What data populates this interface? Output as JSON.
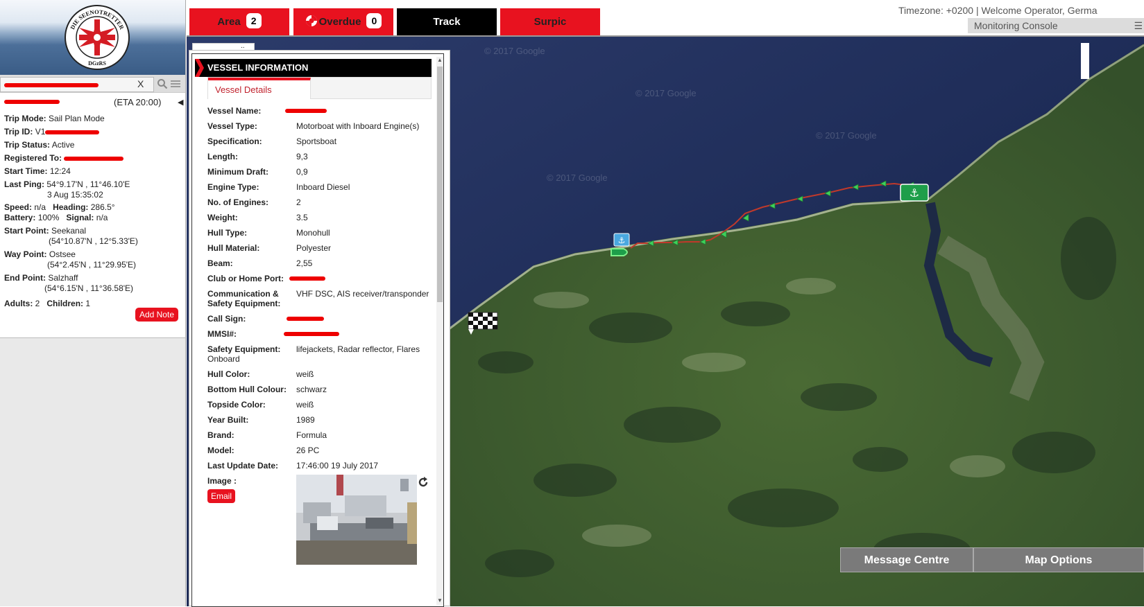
{
  "tabs": [
    {
      "label": "Area",
      "count": "2"
    },
    {
      "label": "Overdue",
      "count": "0"
    },
    {
      "label": "Track"
    },
    {
      "label": "Surpic"
    }
  ],
  "header": {
    "timezone_text": "Timezone: +0200 | Welcome Operator, Germa",
    "console_label": "Monitoring Console"
  },
  "logo": {
    "text_top": "DIE SEENOTRETTER",
    "text_bottom": "DGzRS"
  },
  "search": {
    "value": "",
    "clear_label": "X"
  },
  "trip": {
    "eta": "(ETA 20:00)",
    "trip_mode_label": "Trip Mode:",
    "trip_mode": "Sail Plan Mode",
    "trip_id_label": "Trip ID:",
    "trip_id_prefix": "V1",
    "trip_status_label": "Trip Status:",
    "trip_status": "Active",
    "registered_label": "Registered To:",
    "start_time_label": "Start Time:",
    "start_time": "12:24",
    "last_ping_label": "Last Ping:",
    "last_ping_coords": "54°9.17'N , 11°46.10'E",
    "last_ping_date": "3 Aug 15:35:02",
    "speed_label": "Speed:",
    "speed": "n/a",
    "heading_label": "Heading:",
    "heading": "286.5°",
    "battery_label": "Battery:",
    "battery": "100%",
    "signal_label": "Signal:",
    "signal": "n/a",
    "start_point_label": "Start Point:",
    "start_point": "Seekanal",
    "start_point_coords": "(54°10.87'N , 12°5.33'E)",
    "way_point_label": "Way Point:",
    "way_point": "Ostsee",
    "way_point_coords": "(54°2.45'N , 11°29.95'E)",
    "end_point_label": "End Point:",
    "end_point": "Salzhaff",
    "end_point_coords": "(54°6.15'N , 11°36.58'E)",
    "adults_label": "Adults:",
    "adults": "2",
    "children_label": "Children:",
    "children": "1",
    "add_note_label": "Add Note"
  },
  "vessel": {
    "header": "VESSEL INFORMATION",
    "tab_label": "Vessel Details",
    "fields": [
      {
        "label": "Vessel Name:",
        "value": ""
      },
      {
        "label": "Vessel Type:",
        "value": "Motorboat with Inboard Engine(s)"
      },
      {
        "label": "Specification:",
        "value": "Sportsboat"
      },
      {
        "label": "Length:",
        "value": "9,3"
      },
      {
        "label": "Minimum Draft:",
        "value": "0,9"
      },
      {
        "label": "Engine Type:",
        "value": "Inboard Diesel"
      },
      {
        "label": "No. of Engines:",
        "value": "2"
      },
      {
        "label": "Weight:",
        "value": "3.5"
      },
      {
        "label": "Hull Type:",
        "value": "Monohull"
      },
      {
        "label": "Hull Material:",
        "value": "Polyester"
      },
      {
        "label": "Beam:",
        "value": "2,55"
      },
      {
        "label": "Club or Home Port:",
        "value": ""
      },
      {
        "label": "Communication & Safety Equipment:",
        "value": "VHF DSC, AIS receiver/transponder"
      },
      {
        "label": "Call Sign:",
        "value": ""
      },
      {
        "label": "MMSI#:",
        "value": ""
      },
      {
        "label": "Safety Equipment:",
        "value": "lifejackets, Radar reflector, Flares"
      },
      {
        "label": "Hull Color:",
        "value": "weiß"
      },
      {
        "label": "Bottom Hull Colour:",
        "value": "schwarz"
      },
      {
        "label": "Topside Color:",
        "value": "weiß"
      },
      {
        "label": "Year Built:",
        "value": "1989"
      },
      {
        "label": "Brand:",
        "value": "Formula"
      },
      {
        "label": "Model:",
        "value": "26 PC"
      },
      {
        "label": "Last Update Date:",
        "value": "17:46:00 19 July 2017"
      }
    ],
    "safety_onboard_suffix": "Onboard",
    "image_label": "Image :",
    "email_label": "Email"
  },
  "map": {
    "watermark": "© 2017 Google",
    "message_centre_label": "Message Centre",
    "map_options_label": "Map Options",
    "colors": {
      "sea": "#1c2a55",
      "land": "#3e5a2c",
      "route": "#c0392b",
      "marker": "#1e9e4a"
    }
  }
}
